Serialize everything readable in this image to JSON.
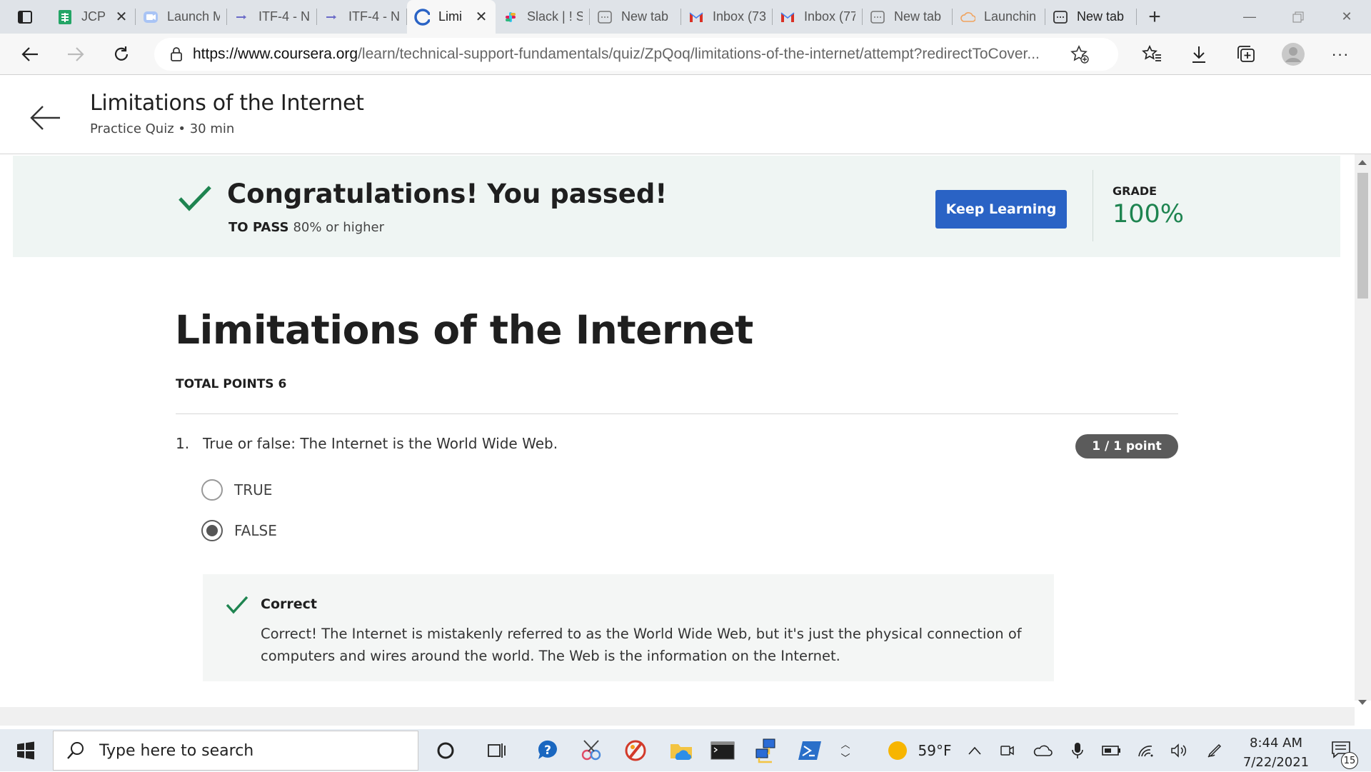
{
  "browser": {
    "tabs": [
      {
        "title": "JCP",
        "icon": "sheets-icon",
        "active": false,
        "closable": true
      },
      {
        "title": "Launch M",
        "icon": "zoom-icon",
        "active": false
      },
      {
        "title": "ITF-4 - N",
        "icon": "arrow-icon",
        "active": false
      },
      {
        "title": "ITF-4 - N",
        "icon": "arrow-icon",
        "active": false
      },
      {
        "title": "Limi",
        "icon": "coursera-icon",
        "active": true,
        "closable": true
      },
      {
        "title": "Slack | ! S",
        "icon": "slack-icon",
        "active": false
      },
      {
        "title": "New tab",
        "icon": "newtab-icon",
        "active": false
      },
      {
        "title": "Inbox (73",
        "icon": "gmail-icon",
        "active": false
      },
      {
        "title": "Inbox (77",
        "icon": "gmail-icon",
        "active": false
      },
      {
        "title": "New tab",
        "icon": "newtab-icon",
        "active": false
      },
      {
        "title": "Launchin",
        "icon": "cloud-icon",
        "active": false
      },
      {
        "title": "New tab",
        "icon": "newtab-icon",
        "active": false
      }
    ],
    "url_host": "https://www.coursera.org",
    "url_path": "/learn/technical-support-fundamentals/quiz/ZpQoq/limitations-of-the-internet/attempt?redirectToCover..."
  },
  "header": {
    "title": "Limitations of the Internet",
    "subtitle": "Practice Quiz • 30 min"
  },
  "banner": {
    "congrats": "Congratulations! You passed!",
    "to_pass_label": "TO PASS",
    "to_pass_value": "80% or higher",
    "button_label": "Keep Learning",
    "grade_label": "GRADE",
    "grade_value": "100%"
  },
  "quiz": {
    "title": "Limitations of the Internet",
    "total_points": "TOTAL POINTS 6",
    "question": {
      "number": "1.",
      "text": "True or false: The Internet is the World Wide Web.",
      "points": "1 / 1 point",
      "options": [
        {
          "label": "TRUE",
          "selected": false
        },
        {
          "label": "FALSE",
          "selected": true
        }
      ],
      "feedback_title": "Correct",
      "feedback_text": "Correct! The Internet is mistakenly referred to as the World Wide Web, but it's just the physical connection of computers and wires around the world. The Web is the information on the Internet."
    }
  },
  "taskbar": {
    "search_placeholder": "Type here to search",
    "weather": "59°F",
    "time": "8:44 AM",
    "date": "7/22/2021",
    "notification_count": "15"
  },
  "colors": {
    "accent_blue": "#2a63c5",
    "success_green": "#1e8450",
    "banner_bg": "#eff5f3"
  }
}
